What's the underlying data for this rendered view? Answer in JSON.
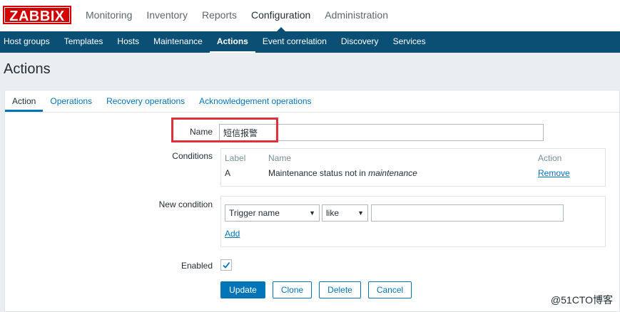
{
  "brand": {
    "logo_text": "ZABBIX"
  },
  "top_nav": [
    "Monitoring",
    "Inventory",
    "Reports",
    "Configuration",
    "Administration"
  ],
  "sub_nav": [
    "Host groups",
    "Templates",
    "Hosts",
    "Maintenance",
    "Actions",
    "Event correlation",
    "Discovery",
    "Services"
  ],
  "page": {
    "title": "Actions"
  },
  "tabs": [
    "Action",
    "Operations",
    "Recovery operations",
    "Acknowledgement operations"
  ],
  "form": {
    "name_label": "Name",
    "name_value": "短信报警",
    "conditions_label": "Conditions",
    "conditions_headers": {
      "label": "Label",
      "name": "Name",
      "action": "Action"
    },
    "conditions_rows": [
      {
        "label": "A",
        "name_prefix": "Maintenance status not in ",
        "name_emph": "maintenance",
        "action": "Remove"
      }
    ],
    "new_condition_label": "New condition",
    "new_condition_type": "Trigger name",
    "new_condition_operator": "like",
    "new_condition_value": "",
    "add_link": "Add",
    "enabled_label": "Enabled",
    "enabled_checked": true
  },
  "buttons": {
    "update": "Update",
    "clone": "Clone",
    "delete": "Delete",
    "cancel": "Cancel"
  },
  "watermark": "@51CTO博客",
  "colors": {
    "brand_red": "#d40000",
    "nav_blue": "#0b4f75",
    "link_blue": "#0275b8",
    "annotation_red": "#e0303b"
  }
}
